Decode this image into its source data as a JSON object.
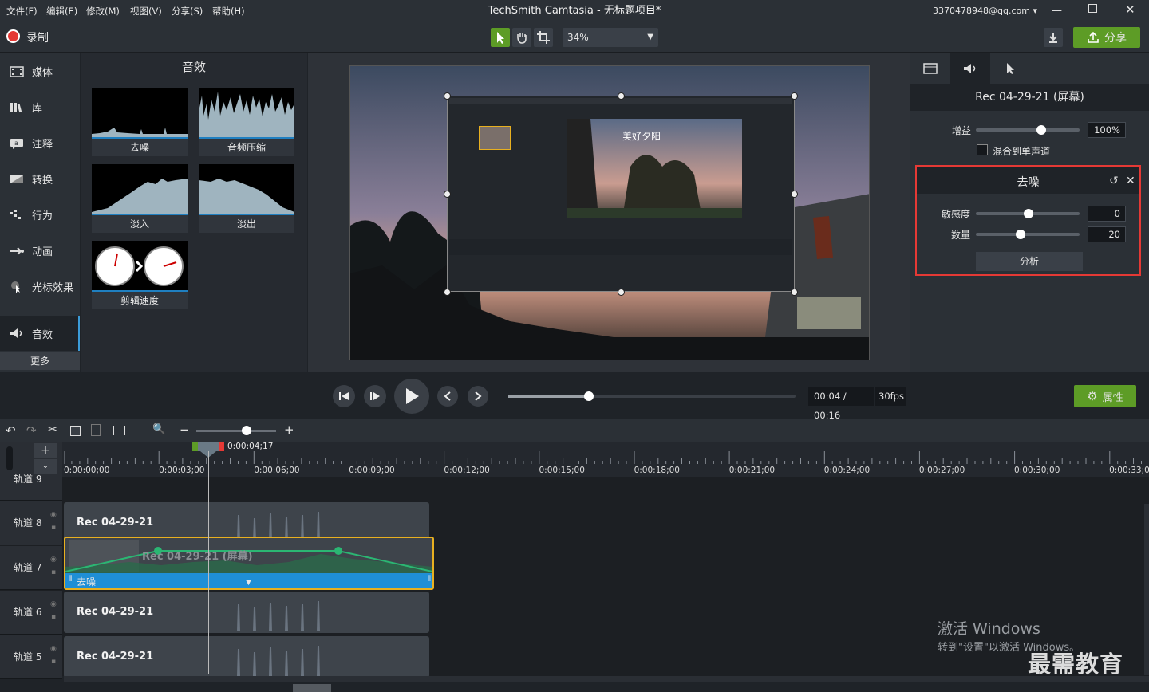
{
  "menubar": {
    "items": [
      "文件(F)",
      "编辑(E)",
      "修改(M)",
      "视图(V)",
      "分享(S)",
      "帮助(H)"
    ]
  },
  "app": {
    "title": "TechSmith Camtasia - 无标题项目*",
    "user": "3370478948@qq.com"
  },
  "toolbar": {
    "record_label": "录制",
    "zoom": "34%",
    "share_label": "分享"
  },
  "left_nav": {
    "items": [
      {
        "label": "媒体",
        "icon": "film-icon"
      },
      {
        "label": "库",
        "icon": "library-icon"
      },
      {
        "label": "注释",
        "icon": "annotation-icon"
      },
      {
        "label": "转换",
        "icon": "transition-icon"
      },
      {
        "label": "行为",
        "icon": "behavior-icon"
      },
      {
        "label": "动画",
        "icon": "animation-icon"
      },
      {
        "label": "光标效果",
        "icon": "cursor-effect-icon"
      },
      {
        "label": "音效",
        "icon": "speaker-icon"
      }
    ],
    "more_label": "更多"
  },
  "effects": {
    "title": "音效",
    "tiles": [
      "去噪",
      "音频压缩",
      "淡入",
      "淡出",
      "剪辑速度"
    ]
  },
  "preview": {
    "caption": "美好夕阳"
  },
  "properties": {
    "clip_title": "Rec 04-29-21 (屏幕)",
    "gain_label": "增益",
    "gain_value": "100%",
    "gain_fraction": 1.0,
    "mono_label": "混合到单声道",
    "denoise": {
      "title": "去噪",
      "sensitivity_label": "敏感度",
      "sensitivity_value": "0",
      "amount_label": "数量",
      "amount_value": "20",
      "analyze_label": "分析"
    }
  },
  "playback": {
    "time": "00:04 / 00:16",
    "fps": "30fps",
    "properties_label": "属性"
  },
  "timeline": {
    "playhead": "0:00:04;17",
    "ticks": [
      "0:00:00;00",
      "0:00:03;00",
      "0:00:06;00",
      "0:00:09;00",
      "0:00:12;00",
      "0:00:15;00",
      "0:00:18;00",
      "0:00:21;00",
      "0:00:24;00",
      "0:00:27;00",
      "0:00:30;00",
      "0:00:33;00"
    ],
    "tracks": [
      {
        "name": "轨道 9",
        "clip": ""
      },
      {
        "name": "轨道 8",
        "clip": "Rec 04-29-21"
      },
      {
        "name": "轨道 7",
        "clip": "Rec 04-29-21 (屏幕)",
        "effect": "去噪"
      },
      {
        "name": "轨道 6",
        "clip": "Rec 04-29-21"
      },
      {
        "name": "轨道 5",
        "clip": "Rec 04-29-21"
      }
    ]
  },
  "watermark": {
    "line1": "激活 Windows",
    "line2": "转到\"设置\"以激活 Windows。",
    "brand": "最需教育"
  },
  "colors": {
    "accent_green": "#5d9c26",
    "highlight_red": "#e53935",
    "clip_blue": "#1f8fd6",
    "selected_yellow": "#e8b020"
  }
}
